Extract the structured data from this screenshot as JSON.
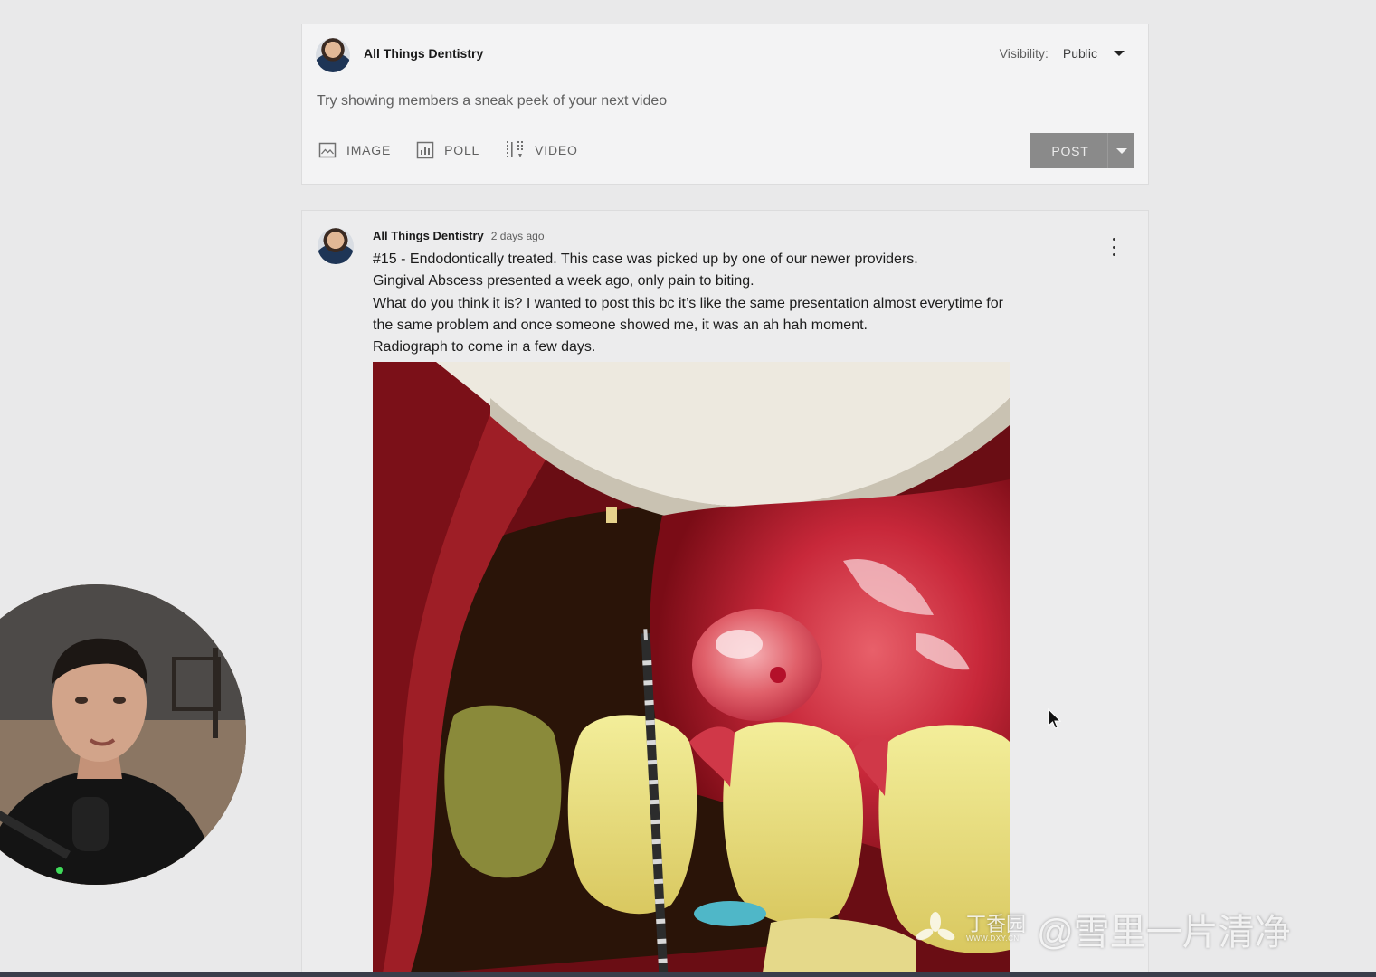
{
  "composer": {
    "channel_name": "All Things Dentistry",
    "visibility_label": "Visibility:",
    "visibility_value": "Public",
    "prompt": "Try showing members a sneak peek of your next video",
    "tools": [
      {
        "label": "IMAGE",
        "icon": "image-icon"
      },
      {
        "label": "POLL",
        "icon": "poll-icon"
      },
      {
        "label": "VIDEO",
        "icon": "video-icon"
      }
    ],
    "post_label": "POST"
  },
  "post": {
    "channel_name": "All Things Dentistry",
    "time": "2 days ago",
    "lines": [
      "#15 - Endodontically treated. This case was picked up by one of our newer providers.",
      "Gingival Abscess presented a week ago, only pain to biting.",
      "What do you think it is?  I wanted to post this bc it’s like the same presentation almost everytime for",
      "the same problem and once someone showed me, it was an ah hah moment.",
      "Radiograph to come in a few days."
    ]
  },
  "watermark": {
    "logo_text": "丁香园",
    "logo_sub": "WWW.DXY.CN",
    "handle": "@雪里一片清净"
  },
  "colors": {
    "page_bg": "#e9e9ea",
    "post_button": "#8a8a8a",
    "secondary_text": "#606060"
  }
}
